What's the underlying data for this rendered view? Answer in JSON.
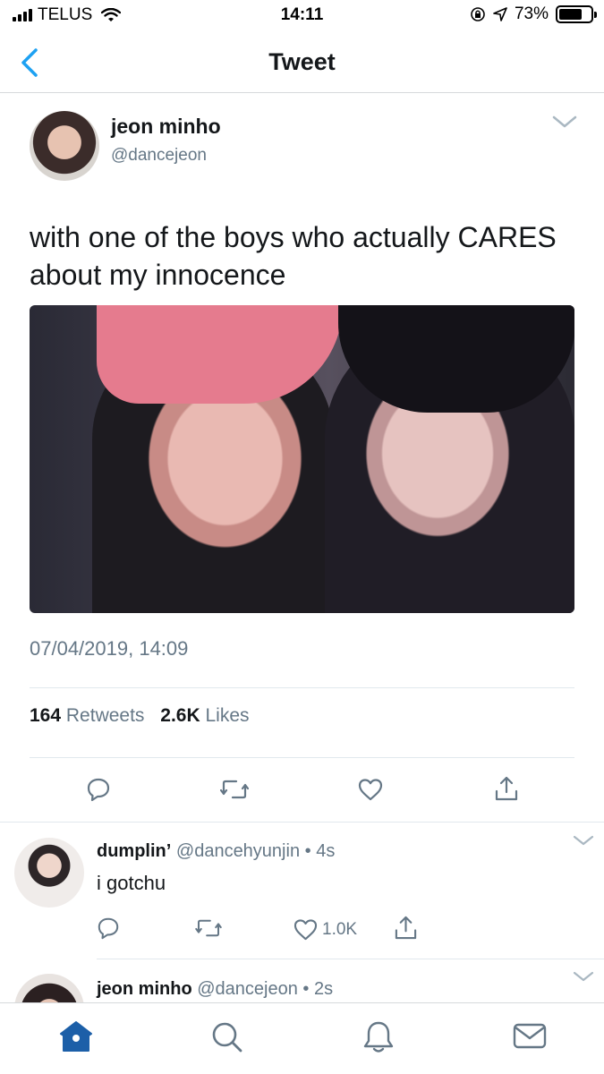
{
  "status_bar": {
    "carrier": "TELUS",
    "time": "14:11",
    "battery_percent": "73%",
    "battery_level": 0.73
  },
  "nav": {
    "title": "Tweet",
    "back_icon": "chevron-left-icon"
  },
  "tweet": {
    "author_name": "jeon minho",
    "author_handle": "@dancejeon",
    "text": "with one of the boys who actually CARES about my innocence",
    "timestamp": "07/04/2019, 14:09",
    "retweets_count": "164",
    "retweets_label": "Retweets",
    "likes_count": "2.6K",
    "likes_label": "Likes",
    "actions": [
      "reply-icon",
      "retweet-icon",
      "like-icon",
      "share-icon"
    ]
  },
  "replies": [
    {
      "name": "dumplin’",
      "handle": "@dancehyunjin",
      "time": "4s",
      "text": "i gotchu",
      "like_count": "1.0K"
    },
    {
      "name": "jeon minho",
      "handle": "@dancejeon",
      "time": "2s"
    }
  ],
  "separator": "•",
  "tab_bar": [
    "home-icon",
    "search-icon",
    "notifications-icon",
    "messages-icon"
  ],
  "colors": {
    "accent": "#1da1f2",
    "home_active": "#1c5fa8",
    "secondary_text": "#657786",
    "divider": "#e1e8ed"
  }
}
